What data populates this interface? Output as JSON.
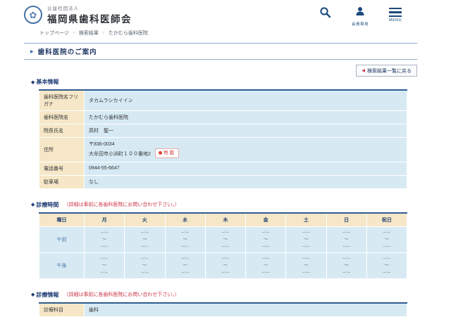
{
  "header": {
    "org_type": "公益社団法人",
    "org_name": "福岡県歯科医師会",
    "emblem_glyph": "✿",
    "search_icon": "magnifier",
    "member_label": "会員専用",
    "menu_label": "MENU"
  },
  "breadcrumb": {
    "separator": "›",
    "items": [
      "トップページ",
      "検索結果",
      "たかむら歯科医院"
    ]
  },
  "page": {
    "title": "歯科医院のご案内",
    "title_marker": "▶",
    "section_marker": "◆",
    "back_arrow": "◀",
    "back_button": "検索結果一覧に戻る"
  },
  "basic_info": {
    "heading": "基本情報",
    "rows": [
      {
        "label": "歯科医院名フリガナ",
        "value": "タカムラシカイイン"
      },
      {
        "label": "歯科医院名",
        "value": "たかむら歯科医院"
      },
      {
        "label": "院長氏名",
        "value": "高村　聖一"
      },
      {
        "label": "住所",
        "lines": [
          "〒836-0034",
          "大牟田市小浜町１００番地2"
        ],
        "map_button": "地図"
      },
      {
        "label": "電話番号",
        "value": "0944-55-6647"
      },
      {
        "label": "駐車場",
        "value": "なし"
      }
    ]
  },
  "hours": {
    "heading": "診療時間",
    "note": "（詳細は事前に各歯科医院にお問い合わせ下さい。）",
    "columns": [
      "曜日",
      "月",
      "火",
      "水",
      "木",
      "金",
      "土",
      "日",
      "祝日"
    ],
    "rows": [
      {
        "label": "午前",
        "cells": [
          "--:--\n～\n--:--",
          "--:--\n～\n--:--",
          "--:--\n～\n--:--",
          "--:--\n～\n--:--",
          "--:--\n～\n--:--",
          "--:--\n～\n--:--",
          "--:--\n～\n--:--",
          "--:--\n～\n--:--"
        ]
      },
      {
        "label": "午後",
        "cells": [
          "--:--\n～\n--:--",
          "--:--\n～\n--:--",
          "--:--\n～\n--:--",
          "--:--\n～\n--:--",
          "--:--\n～\n--:--",
          "--:--\n～\n--:--",
          "--:--\n～\n--:--",
          "--:--\n～\n--:--"
        ]
      }
    ]
  },
  "treatment": {
    "heading": "診療情報",
    "note": "（詳細は事前に各歯科医院にお問い合わせ下さい。）",
    "rows": [
      {
        "label": "診療科目",
        "value": "歯科"
      }
    ]
  },
  "colors": {
    "accent_navy": "#1b4a7e",
    "label_beige": "#f5e7c8",
    "value_blue": "#d7eaf4",
    "note_red": "#cc3344",
    "rule_blue": "#88aed0"
  }
}
